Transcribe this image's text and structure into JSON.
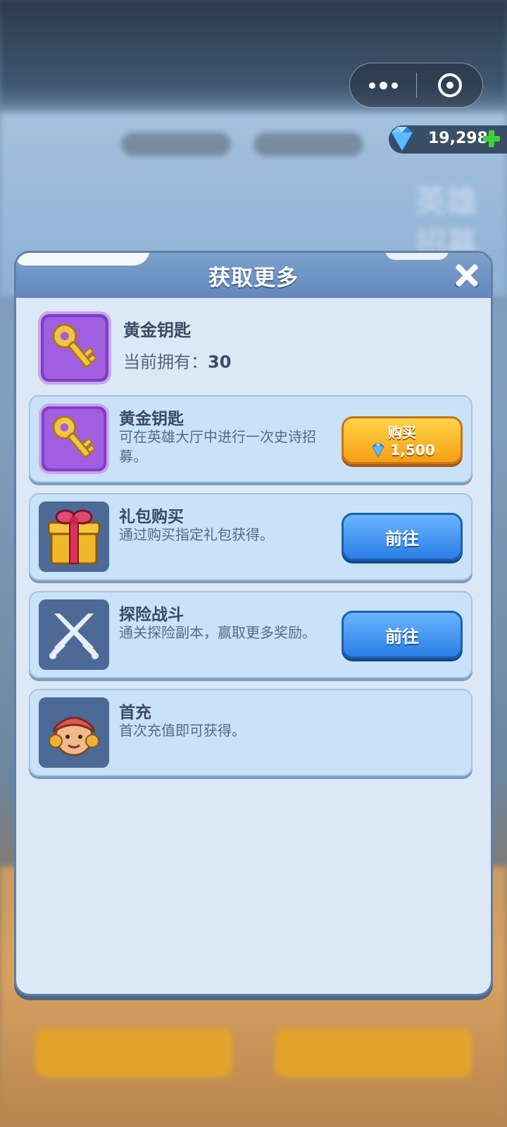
{
  "hud": {
    "gem_count": "19,298"
  },
  "modal": {
    "title": "获取更多",
    "item": {
      "name": "黄金钥匙",
      "owned_label": "当前拥有：",
      "owned_value": "30"
    },
    "rows": [
      {
        "title": "黄金钥匙",
        "desc": "可在英雄大厅中进行一次史诗招募。",
        "button": {
          "label": "购买",
          "price": "1,500"
        }
      },
      {
        "title": "礼包购买",
        "desc": "通过购买指定礼包获得。",
        "button": {
          "label": "前往"
        }
      },
      {
        "title": "探险战斗",
        "desc": "通关探险副本，赢取更多奖励。",
        "button": {
          "label": "前往"
        }
      },
      {
        "title": "首充",
        "desc": "首次充值即可获得。"
      }
    ]
  }
}
